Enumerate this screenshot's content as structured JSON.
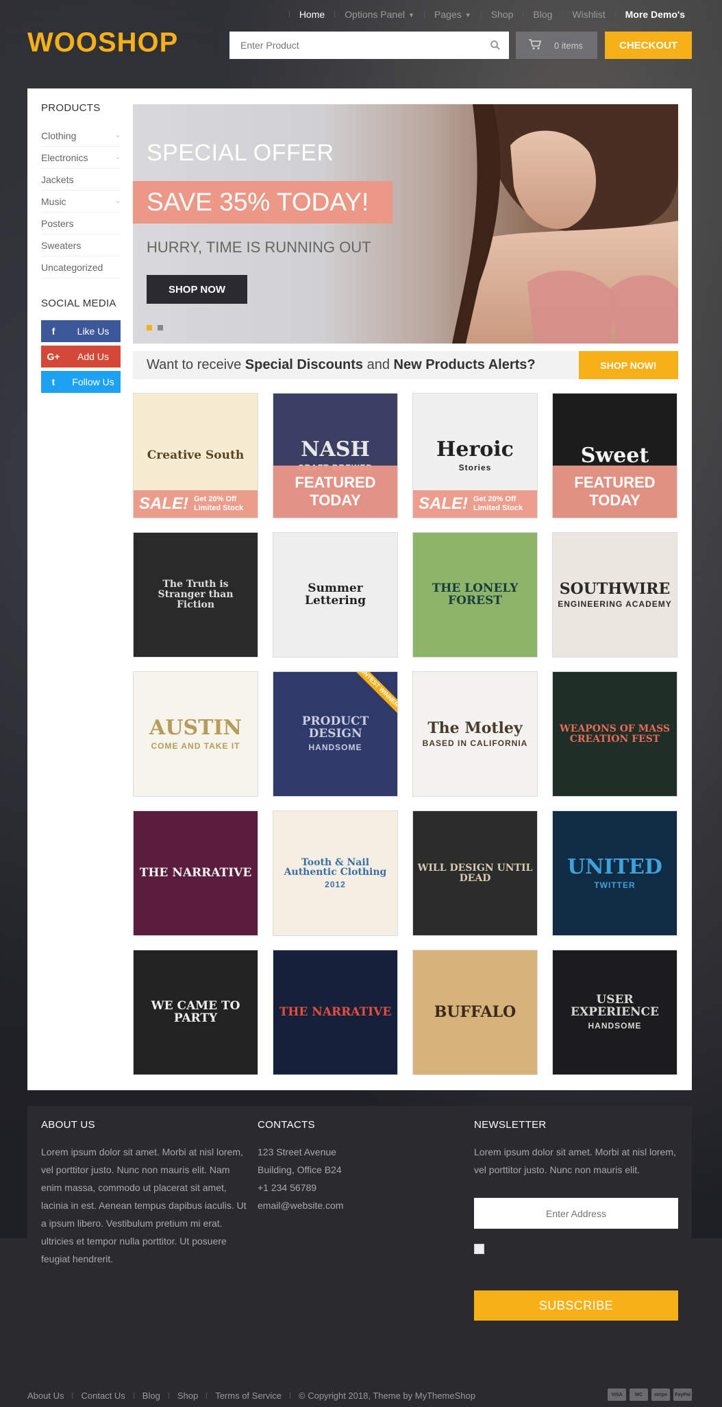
{
  "header": {
    "nav": [
      {
        "label": "Home",
        "active": true,
        "caret": false,
        "bold": false
      },
      {
        "label": "Options Panel",
        "active": false,
        "caret": true,
        "bold": false
      },
      {
        "label": "Pages",
        "active": false,
        "caret": true,
        "bold": false
      },
      {
        "label": "Shop",
        "active": false,
        "caret": false,
        "bold": false
      },
      {
        "label": "Blog",
        "active": false,
        "caret": false,
        "bold": false
      },
      {
        "label": "Wishlist",
        "active": false,
        "caret": false,
        "bold": false
      },
      {
        "label": "More Demo's",
        "active": false,
        "caret": false,
        "bold": true
      }
    ],
    "logo": "WOOSHOP",
    "search_placeholder": "Enter Product",
    "cart_label": "0 items",
    "checkout_label": "CHECKOUT"
  },
  "sidebar": {
    "products_title": "PRODUCTS",
    "categories": [
      {
        "label": "Clothing",
        "has_children": true
      },
      {
        "label": "Electronics",
        "has_children": true
      },
      {
        "label": "Jackets",
        "has_children": false
      },
      {
        "label": "Music",
        "has_children": true
      },
      {
        "label": "Posters",
        "has_children": false
      },
      {
        "label": "Sweaters",
        "has_children": false
      },
      {
        "label": "Uncategorized",
        "has_children": false
      }
    ],
    "social_title": "SOCIAL MEDIA",
    "social": [
      {
        "label": "Like Us",
        "icon": "f",
        "network": "facebook"
      },
      {
        "label": "Add Us",
        "icon": "G+",
        "network": "google-plus"
      },
      {
        "label": "Follow Us",
        "icon": "t",
        "network": "twitter"
      }
    ]
  },
  "hero": {
    "kicker": "SPECIAL OFFER",
    "headline": "SAVE 35% TODAY!",
    "subline": "HURRY, TIME IS RUNNING OUT",
    "cta": "SHOP NOW",
    "slides": 2,
    "active_slide": 1
  },
  "promo": {
    "text_pre": "Want to receive ",
    "text_b1": "Special Discounts",
    "text_mid": " and ",
    "text_b2": "New Products Alerts?",
    "cta": "SHOP NOW!"
  },
  "products": [
    {
      "art": "Creative South",
      "sub": "",
      "bg": "#f6ecd2",
      "fg": "#5a4424",
      "badge": "sale"
    },
    {
      "art": "NASH",
      "sub": "CRAFT BREWED",
      "bg": "#3a3f63",
      "fg": "#e8e8e8",
      "badge": "featured"
    },
    {
      "art": "Heroic",
      "sub": "Stories",
      "bg": "#f0f0f0",
      "fg": "#222222",
      "badge": "sale"
    },
    {
      "art": "Sweet",
      "sub": "",
      "bg": "#1c1c1c",
      "fg": "#f4f4f4",
      "badge": "featured"
    },
    {
      "art": "The Truth is Stranger than Fiction",
      "sub": "",
      "bg": "#2a2a2a",
      "fg": "#dddddd",
      "badge": ""
    },
    {
      "art": "Summer Lettering",
      "sub": "",
      "bg": "#eeeeee",
      "fg": "#222222",
      "badge": ""
    },
    {
      "art": "THE LONELY FOREST",
      "sub": "",
      "bg": "#8db56a",
      "fg": "#1d3b3f",
      "badge": ""
    },
    {
      "art": "SOUTHWIRE",
      "sub": "ENGINEERING ACADEMY",
      "bg": "#ebe7e0",
      "fg": "#2a2a2a",
      "badge": ""
    },
    {
      "art": "AUSTIN",
      "sub": "COME AND TAKE IT",
      "bg": "#f7f4ec",
      "fg": "#b79b5a",
      "badge": ""
    },
    {
      "art": "PRODUCT DESIGN",
      "sub": "HANDSOME",
      "bg": "#2f3a6b",
      "fg": "#c8cde0",
      "badge": "contest"
    },
    {
      "art": "The Motley",
      "sub": "BASED IN CALIFORNIA",
      "bg": "#f4f2ee",
      "fg": "#4a3b30",
      "badge": ""
    },
    {
      "art": "WEAPONS OF MASS CREATION FEST",
      "sub": "",
      "bg": "#1f2f28",
      "fg": "#e86a58",
      "badge": ""
    },
    {
      "art": "THE NARRATIVE",
      "sub": "",
      "bg": "#5a1d3e",
      "fg": "#f4f4f4",
      "badge": ""
    },
    {
      "art": "Tooth & Nail Authentic Clothing",
      "sub": "2012",
      "bg": "#f4efe2",
      "fg": "#3a6ea8",
      "badge": ""
    },
    {
      "art": "WILL DESIGN UNTIL DEAD",
      "sub": "",
      "bg": "#2c2c2c",
      "fg": "#d8cbb0",
      "badge": ""
    },
    {
      "art": "UNITED",
      "sub": "TWITTER",
      "bg": "#102c44",
      "fg": "#3ea2dc",
      "badge": ""
    },
    {
      "art": "WE CAME TO PARTY",
      "sub": "",
      "bg": "#222222",
      "fg": "#f0f0f0",
      "badge": ""
    },
    {
      "art": "THE NARRATIVE",
      "sub": "",
      "bg": "#15213a",
      "fg": "#e84c3d",
      "badge": ""
    },
    {
      "art": "BUFFALO",
      "sub": "",
      "bg": "#d6b37a",
      "fg": "#3a2a1a",
      "badge": ""
    },
    {
      "art": "USER EXPERIENCE",
      "sub": "HANDSOME",
      "bg": "#1c1c1e",
      "fg": "#d8d8d8",
      "badge": ""
    }
  ],
  "badges": {
    "featured_line1": "FEATURED",
    "featured_line2": "TODAY",
    "sale_big": "SALE!",
    "sale_small1": "Get 20% Off",
    "sale_small2": "Limited Stock",
    "contest": "CONTEST WINNER"
  },
  "footer": {
    "about_title": "ABOUT US",
    "about_text": "Lorem ipsum dolor sit amet. Morbi at nisl lorem, vel porttitor justo. Nunc non mauris elit. Nam enim massa, commodo ut placerat sit amet, lacinia in est. Aenean tempus dapibus iaculis. Ut a ipsum libero. Vestibulum pretium mi erat. ultricies et tempor nulla porttitor. Ut posuere feugiat hendrerit.",
    "contacts_title": "CONTACTS",
    "contacts": [
      "123 Street Avenue",
      "Building, Office B24",
      "+1 234 56789",
      "email@website.com"
    ],
    "newsletter_title": "NEWSLETTER",
    "newsletter_text": "Lorem ipsum dolor sit amet. Morbi at nisl lorem, vel porttitor justo. Nunc non mauris elit.",
    "newsletter_placeholder": "Enter Address",
    "subscribe_label": "SUBSCRIBE"
  },
  "bottom": {
    "links": [
      "About Us",
      "Contact Us",
      "Blog",
      "Shop",
      "Terms of Service"
    ],
    "copyright": "© Copyright 2018, Theme by MyThemeShop",
    "payments": [
      "VISA",
      "MC",
      "stripe",
      "PayPal"
    ]
  },
  "colors": {
    "accent": "#f7b018",
    "salmon": "#eb9887",
    "dark": "#2b2a2e"
  }
}
